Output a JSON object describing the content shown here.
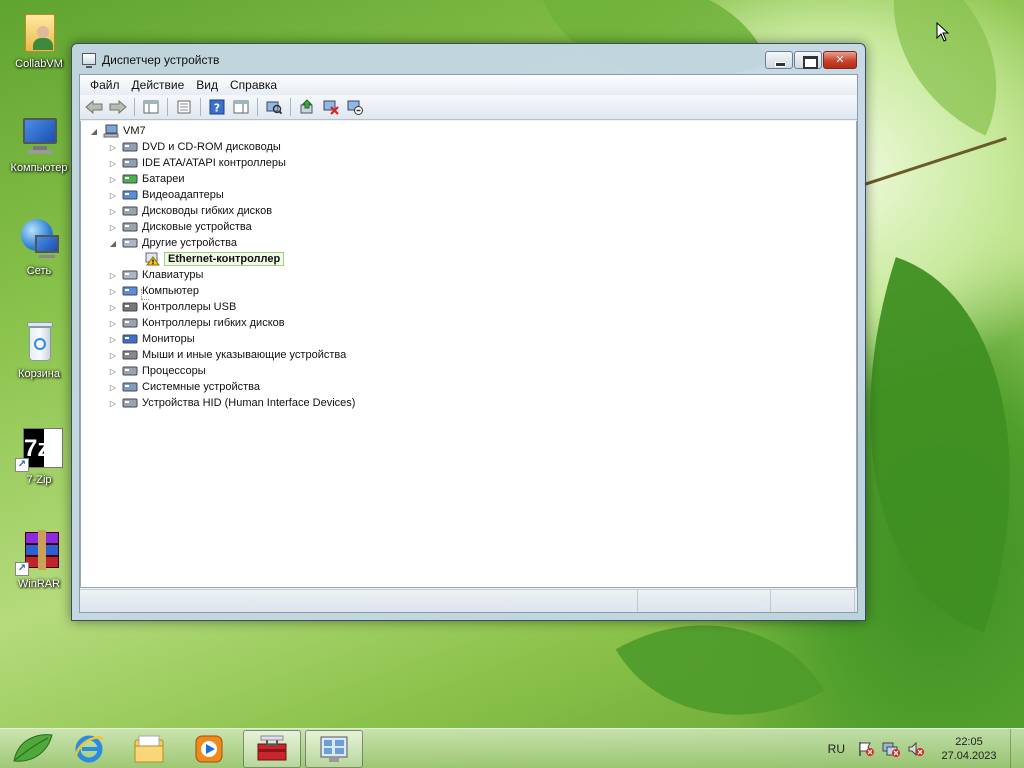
{
  "desktop": {
    "icons": [
      {
        "label": "CollabVM",
        "icon": "user-folder-icon"
      },
      {
        "label": "Компьютер",
        "icon": "computer-icon"
      },
      {
        "label": "Сеть",
        "icon": "network-icon"
      },
      {
        "label": "Корзина",
        "icon": "recycle-bin-icon"
      },
      {
        "label": "7-Zip",
        "icon": "7zip-icon",
        "logo_text": "7z"
      },
      {
        "label": "WinRAR",
        "icon": "winrar-icon"
      }
    ]
  },
  "window": {
    "title": "Диспетчер устройств",
    "menu": [
      "Файл",
      "Действие",
      "Вид",
      "Справка"
    ],
    "toolbar": [
      "back-icon",
      "forward-icon",
      "console-tree-icon",
      "properties-icon",
      "help-icon",
      "action-pane-icon",
      "scan-hardware-icon",
      "update-driver-icon",
      "uninstall-icon",
      "disable-icon"
    ],
    "close_glyph": "✕",
    "tree": {
      "root": "VM7",
      "categories": [
        {
          "label": "DVD и CD-ROM дисководы",
          "icon": "dvd-drive-icon",
          "expanded": false
        },
        {
          "label": "IDE ATA/ATAPI контроллеры",
          "icon": "ide-controller-icon",
          "expanded": false
        },
        {
          "label": "Батареи",
          "icon": "battery-icon",
          "expanded": false
        },
        {
          "label": "Видеоадаптеры",
          "icon": "display-adapter-icon",
          "expanded": false
        },
        {
          "label": "Дисководы гибких дисков",
          "icon": "floppy-drive-icon",
          "expanded": false
        },
        {
          "label": "Дисковые устройства",
          "icon": "disk-drive-icon",
          "expanded": false
        },
        {
          "label": "Другие устройства",
          "icon": "other-devices-icon",
          "expanded": true,
          "children": [
            {
              "label": "Ethernet-контроллер",
              "icon": "warning-device-icon",
              "selected": true
            }
          ]
        },
        {
          "label": "Клавиатуры",
          "icon": "keyboard-icon",
          "expanded": false
        },
        {
          "label": "Компьютер",
          "icon": "computer-icon",
          "expanded": false
        },
        {
          "label": "Контроллеры USB",
          "icon": "usb-icon",
          "expanded": false
        },
        {
          "label": "Контроллеры гибких дисков",
          "icon": "floppy-controller-icon",
          "expanded": false
        },
        {
          "label": "Мониторы",
          "icon": "monitor-icon",
          "expanded": false
        },
        {
          "label": "Мыши и иные указывающие устройства",
          "icon": "mouse-icon",
          "expanded": false
        },
        {
          "label": "Процессоры",
          "icon": "processor-icon",
          "expanded": false
        },
        {
          "label": "Системные устройства",
          "icon": "system-devices-icon",
          "expanded": false
        },
        {
          "label": "Устройства HID (Human Interface Devices)",
          "icon": "hid-icon",
          "expanded": false
        }
      ]
    }
  },
  "taskbar": {
    "apps": [
      "start-orb-icon",
      "internet-explorer-icon",
      "explorer-icon",
      "media-player-icon",
      "toolbox-icon",
      "device-manager-icon"
    ],
    "language": "RU",
    "tray_icons": [
      "action-center-icon",
      "network-tray-icon",
      "volume-muted-icon"
    ],
    "time": "22:05",
    "date": "27.04.2023"
  }
}
